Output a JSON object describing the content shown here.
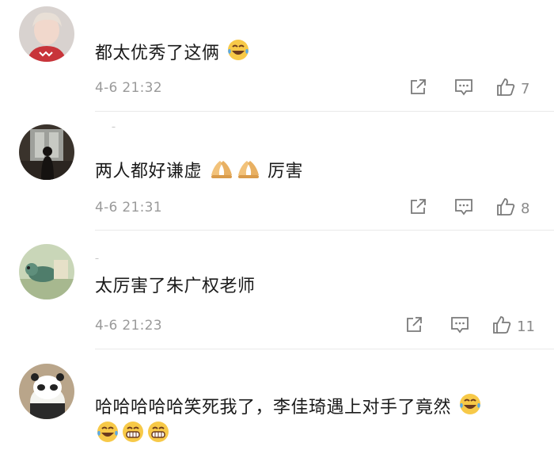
{
  "comments": [
    {
      "text_before": "都太优秀了这俩",
      "time": "4-6 21:32",
      "likes": "7"
    },
    {
      "text_before": "两人都好谦虚",
      "text_after": "厉害",
      "time": "4-6 21:31",
      "likes": "8"
    },
    {
      "text_before": "太厉害了朱广权老师",
      "time": "4-6 21:23",
      "likes": "11"
    },
    {
      "text_line1": "哈哈哈哈哈笑死我了，李佳琦遇上对手了竟然"
    }
  ],
  "icons": {
    "share": "share-icon",
    "reply": "comment-icon",
    "like": "thumbs-up-icon",
    "laugh": "laughing-tears-emoji",
    "grin": "grinning-emoji",
    "clap": "clasped-hands-emoji"
  },
  "colors": {
    "meta": "#9a9a9a",
    "icon": "#7a7a7a",
    "divider": "#e9e9e9"
  }
}
